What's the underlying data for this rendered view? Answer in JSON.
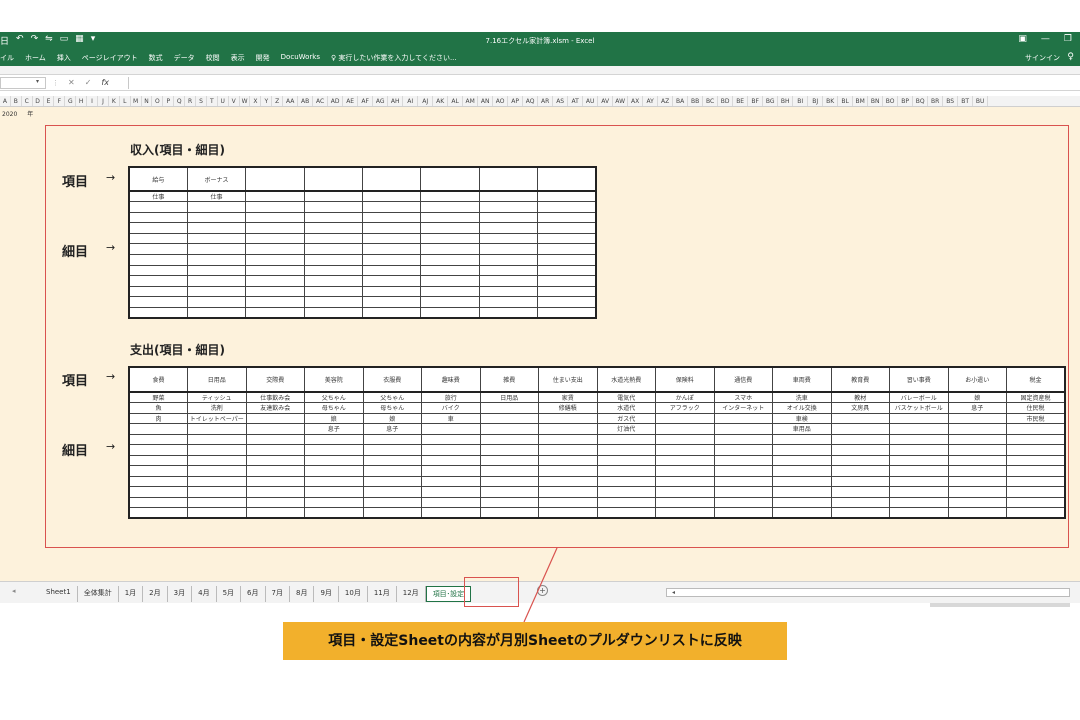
{
  "window": {
    "title": "7.16エクセル家計簿.xlsm - Excel",
    "qat_glyphs": [
      "日",
      "↶",
      "↷",
      "⇋",
      "▭",
      "▦",
      "▾"
    ],
    "signin": "サインイン"
  },
  "ribbon": {
    "tabs": [
      "イル",
      "ホーム",
      "挿入",
      "ページレイアウト",
      "数式",
      "データ",
      "校閲",
      "表示",
      "開発",
      "DocuWorks",
      "♀ 実行したい作業を入力してください..."
    ]
  },
  "formula_bar": {
    "cancel": "✕",
    "enter": "✓",
    "fx": "fx"
  },
  "columns": [
    "A",
    "B",
    "C",
    "D",
    "E",
    "F",
    "G",
    "H",
    "I",
    "J",
    "K",
    "L",
    "M",
    "N",
    "O",
    "P",
    "Q",
    "R",
    "S",
    "T",
    "U",
    "V",
    "W",
    "X",
    "Y",
    "Z",
    "AA",
    "AB",
    "AC",
    "AD",
    "AE",
    "AF",
    "AG",
    "AH",
    "AI",
    "AJ",
    "AK",
    "AL",
    "AM",
    "AN",
    "AO",
    "AP",
    "AQ",
    "AR",
    "AS",
    "AT",
    "AU",
    "AV",
    "AW",
    "AX",
    "AY",
    "AZ",
    "BA",
    "BB",
    "BC",
    "BD",
    "BE",
    "BF",
    "BG",
    "BH",
    "BI",
    "BJ",
    "BK",
    "BL",
    "BM",
    "BN",
    "BO",
    "BP",
    "BQ",
    "BR",
    "BS",
    "BT",
    "BU"
  ],
  "row1": {
    "year": "2020",
    "suffix": "年"
  },
  "income": {
    "title": "収入(項目・細目)",
    "item_label": "項目",
    "detail_label": "細目",
    "arrow": "→",
    "headers": [
      "給与",
      "ボーナス",
      "",
      "",
      "",
      "",
      "",
      ""
    ],
    "details": [
      [
        "仕事",
        "仕事",
        "",
        "",
        "",
        "",
        "",
        ""
      ]
    ]
  },
  "expense": {
    "title": "支出(項目・細目)",
    "item_label": "項目",
    "detail_label": "細目",
    "arrow": "→",
    "headers": [
      "食費",
      "日用品",
      "交際費",
      "美容院",
      "衣服費",
      "趣味費",
      "雑費",
      "住まい支出",
      "水道光熱費",
      "保険料",
      "通信費",
      "車両費",
      "教育費",
      "習い事費",
      "お小遣い",
      "税金"
    ],
    "details": [
      [
        "野菜",
        "ティッシュ",
        "仕事飲み会",
        "父ちゃん",
        "父ちゃん",
        "旅行",
        "日用品",
        "家賃",
        "電気代",
        "かんぽ",
        "スマホ",
        "洗車",
        "教材",
        "バレーボール",
        "娘",
        "固定資産税"
      ],
      [
        "魚",
        "洗剤",
        "友達飲み会",
        "母ちゃん",
        "母ちゃん",
        "バイク",
        "",
        "修繕積",
        "水道代",
        "アフラック",
        "インターネット",
        "オイル交換",
        "文房具",
        "バスケットボール",
        "息子",
        "住民税"
      ],
      [
        "肉",
        "トイレットペーパー",
        "",
        "娘",
        "娘",
        "車",
        "",
        "",
        "ガス代",
        "",
        "",
        "車検",
        "",
        "",
        "",
        "市民税"
      ],
      [
        "",
        "",
        "",
        "息子",
        "息子",
        "",
        "",
        "",
        "灯油代",
        "",
        "",
        "車用品",
        "",
        "",
        "",
        ""
      ]
    ]
  },
  "sheet_tabs": [
    "Sheet1",
    "全体集計",
    "1月",
    "2月",
    "3月",
    "4月",
    "5月",
    "6月",
    "7月",
    "8月",
    "9月",
    "10月",
    "11月",
    "12月",
    "項目･設定"
  ],
  "active_tab": "項目･設定",
  "callout": "項目・設定Sheetの内容が月別Sheetのプルダウンリストに反映"
}
